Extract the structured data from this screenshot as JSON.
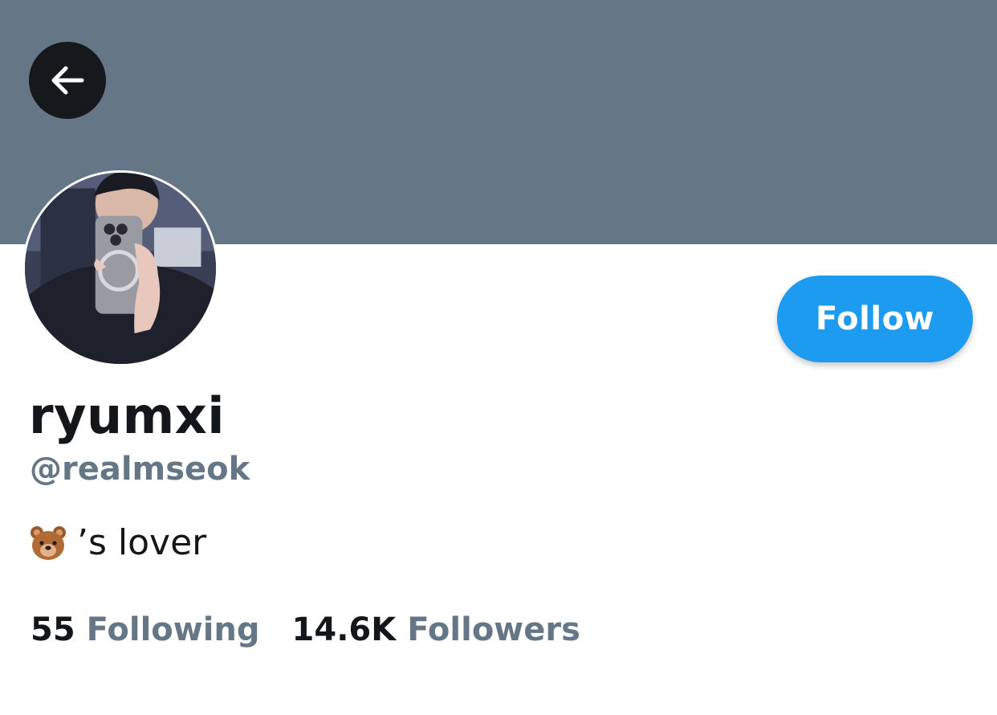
{
  "theme": {
    "banner_color": "#657786",
    "accent": "#1d9bf0",
    "secondary_text": "#657786"
  },
  "header": {
    "back_icon": "arrow-left-icon"
  },
  "profile": {
    "display_name": "ryumxi",
    "handle": "@realmseok",
    "bio_emoji": "bear-face-emoji",
    "bio_text": "’s lover",
    "follow_label": "Follow",
    "stats": [
      {
        "value": "55",
        "label": "Following"
      },
      {
        "value": "14.6K",
        "label": "Followers"
      }
    ]
  }
}
